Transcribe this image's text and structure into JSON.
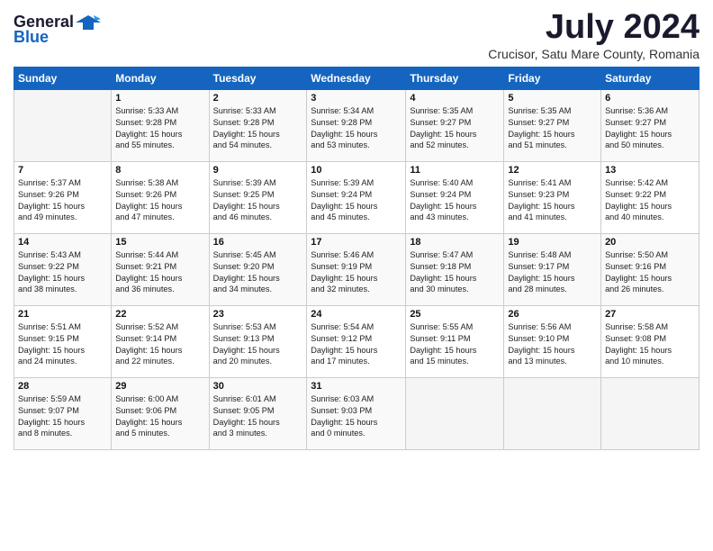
{
  "logo": {
    "general": "General",
    "blue": "Blue"
  },
  "title": "July 2024",
  "subtitle": "Crucisor, Satu Mare County, Romania",
  "days_header": [
    "Sunday",
    "Monday",
    "Tuesday",
    "Wednesday",
    "Thursday",
    "Friday",
    "Saturday"
  ],
  "weeks": [
    [
      {
        "day": "",
        "info": ""
      },
      {
        "day": "1",
        "info": "Sunrise: 5:33 AM\nSunset: 9:28 PM\nDaylight: 15 hours\nand 55 minutes."
      },
      {
        "day": "2",
        "info": "Sunrise: 5:33 AM\nSunset: 9:28 PM\nDaylight: 15 hours\nand 54 minutes."
      },
      {
        "day": "3",
        "info": "Sunrise: 5:34 AM\nSunset: 9:28 PM\nDaylight: 15 hours\nand 53 minutes."
      },
      {
        "day": "4",
        "info": "Sunrise: 5:35 AM\nSunset: 9:27 PM\nDaylight: 15 hours\nand 52 minutes."
      },
      {
        "day": "5",
        "info": "Sunrise: 5:35 AM\nSunset: 9:27 PM\nDaylight: 15 hours\nand 51 minutes."
      },
      {
        "day": "6",
        "info": "Sunrise: 5:36 AM\nSunset: 9:27 PM\nDaylight: 15 hours\nand 50 minutes."
      }
    ],
    [
      {
        "day": "7",
        "info": "Sunrise: 5:37 AM\nSunset: 9:26 PM\nDaylight: 15 hours\nand 49 minutes."
      },
      {
        "day": "8",
        "info": "Sunrise: 5:38 AM\nSunset: 9:26 PM\nDaylight: 15 hours\nand 47 minutes."
      },
      {
        "day": "9",
        "info": "Sunrise: 5:39 AM\nSunset: 9:25 PM\nDaylight: 15 hours\nand 46 minutes."
      },
      {
        "day": "10",
        "info": "Sunrise: 5:39 AM\nSunset: 9:24 PM\nDaylight: 15 hours\nand 45 minutes."
      },
      {
        "day": "11",
        "info": "Sunrise: 5:40 AM\nSunset: 9:24 PM\nDaylight: 15 hours\nand 43 minutes."
      },
      {
        "day": "12",
        "info": "Sunrise: 5:41 AM\nSunset: 9:23 PM\nDaylight: 15 hours\nand 41 minutes."
      },
      {
        "day": "13",
        "info": "Sunrise: 5:42 AM\nSunset: 9:22 PM\nDaylight: 15 hours\nand 40 minutes."
      }
    ],
    [
      {
        "day": "14",
        "info": "Sunrise: 5:43 AM\nSunset: 9:22 PM\nDaylight: 15 hours\nand 38 minutes."
      },
      {
        "day": "15",
        "info": "Sunrise: 5:44 AM\nSunset: 9:21 PM\nDaylight: 15 hours\nand 36 minutes."
      },
      {
        "day": "16",
        "info": "Sunrise: 5:45 AM\nSunset: 9:20 PM\nDaylight: 15 hours\nand 34 minutes."
      },
      {
        "day": "17",
        "info": "Sunrise: 5:46 AM\nSunset: 9:19 PM\nDaylight: 15 hours\nand 32 minutes."
      },
      {
        "day": "18",
        "info": "Sunrise: 5:47 AM\nSunset: 9:18 PM\nDaylight: 15 hours\nand 30 minutes."
      },
      {
        "day": "19",
        "info": "Sunrise: 5:48 AM\nSunset: 9:17 PM\nDaylight: 15 hours\nand 28 minutes."
      },
      {
        "day": "20",
        "info": "Sunrise: 5:50 AM\nSunset: 9:16 PM\nDaylight: 15 hours\nand 26 minutes."
      }
    ],
    [
      {
        "day": "21",
        "info": "Sunrise: 5:51 AM\nSunset: 9:15 PM\nDaylight: 15 hours\nand 24 minutes."
      },
      {
        "day": "22",
        "info": "Sunrise: 5:52 AM\nSunset: 9:14 PM\nDaylight: 15 hours\nand 22 minutes."
      },
      {
        "day": "23",
        "info": "Sunrise: 5:53 AM\nSunset: 9:13 PM\nDaylight: 15 hours\nand 20 minutes."
      },
      {
        "day": "24",
        "info": "Sunrise: 5:54 AM\nSunset: 9:12 PM\nDaylight: 15 hours\nand 17 minutes."
      },
      {
        "day": "25",
        "info": "Sunrise: 5:55 AM\nSunset: 9:11 PM\nDaylight: 15 hours\nand 15 minutes."
      },
      {
        "day": "26",
        "info": "Sunrise: 5:56 AM\nSunset: 9:10 PM\nDaylight: 15 hours\nand 13 minutes."
      },
      {
        "day": "27",
        "info": "Sunrise: 5:58 AM\nSunset: 9:08 PM\nDaylight: 15 hours\nand 10 minutes."
      }
    ],
    [
      {
        "day": "28",
        "info": "Sunrise: 5:59 AM\nSunset: 9:07 PM\nDaylight: 15 hours\nand 8 minutes."
      },
      {
        "day": "29",
        "info": "Sunrise: 6:00 AM\nSunset: 9:06 PM\nDaylight: 15 hours\nand 5 minutes."
      },
      {
        "day": "30",
        "info": "Sunrise: 6:01 AM\nSunset: 9:05 PM\nDaylight: 15 hours\nand 3 minutes."
      },
      {
        "day": "31",
        "info": "Sunrise: 6:03 AM\nSunset: 9:03 PM\nDaylight: 15 hours\nand 0 minutes."
      },
      {
        "day": "",
        "info": ""
      },
      {
        "day": "",
        "info": ""
      },
      {
        "day": "",
        "info": ""
      }
    ]
  ]
}
